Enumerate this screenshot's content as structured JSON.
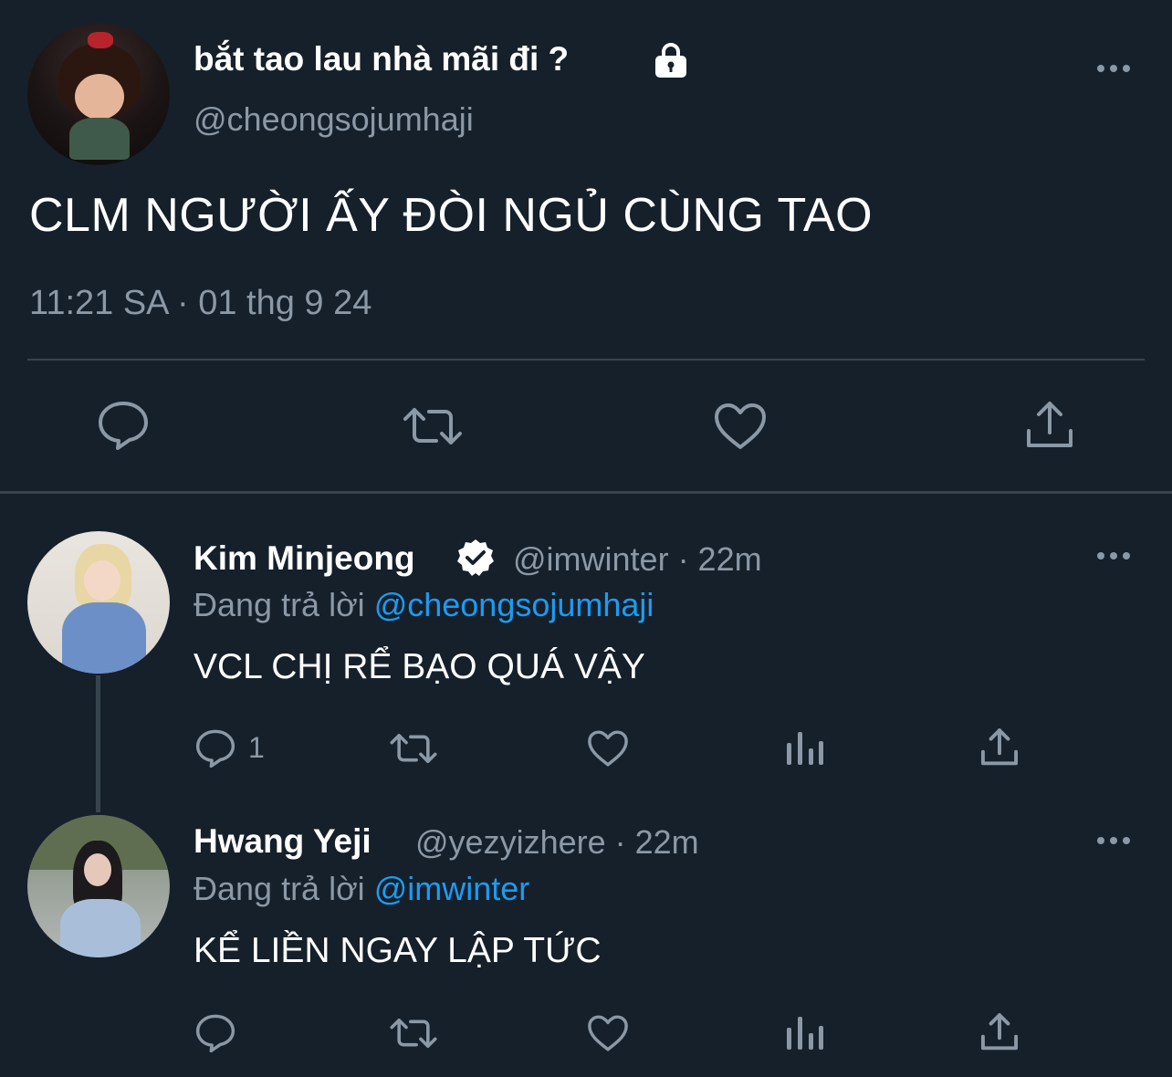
{
  "main_tweet": {
    "display_name": "bắt tao lau nhà mãi đi ?",
    "handle": "@cheongsojumhaji",
    "text": "CLM NGƯỜI ẤY ĐÒI NGỦ CÙNG TAO",
    "timestamp": "11:21 SA · 01 thg 9 24",
    "avatar": "avatar",
    "icons": [
      "lock-icon",
      "more-icon",
      "reply-icon",
      "retweet-icon",
      "like-icon",
      "share-icon"
    ]
  },
  "replies": [
    {
      "display_name": "Kim Minjeong",
      "verified": true,
      "meta": "@imwinter · 22m",
      "reply_prefix": "Đang trả lời ",
      "reply_to": "@cheongsojumhaji",
      "text": "VCL CHỊ RỂ BẠO QUÁ VẬY",
      "reply_count": "1"
    },
    {
      "display_name": "Hwang Yeji",
      "verified": false,
      "meta": "@yezyizhere · 22m",
      "reply_prefix": "Đang trả lời ",
      "reply_to": "@imwinter",
      "text": "KỂ LIỀN NGAY LẬP TỨC",
      "reply_count": ""
    }
  ],
  "colors": {
    "background": "#15202b",
    "secondary_text": "#8b98a5",
    "link": "#1d9bf0",
    "divider": "#38444d"
  }
}
